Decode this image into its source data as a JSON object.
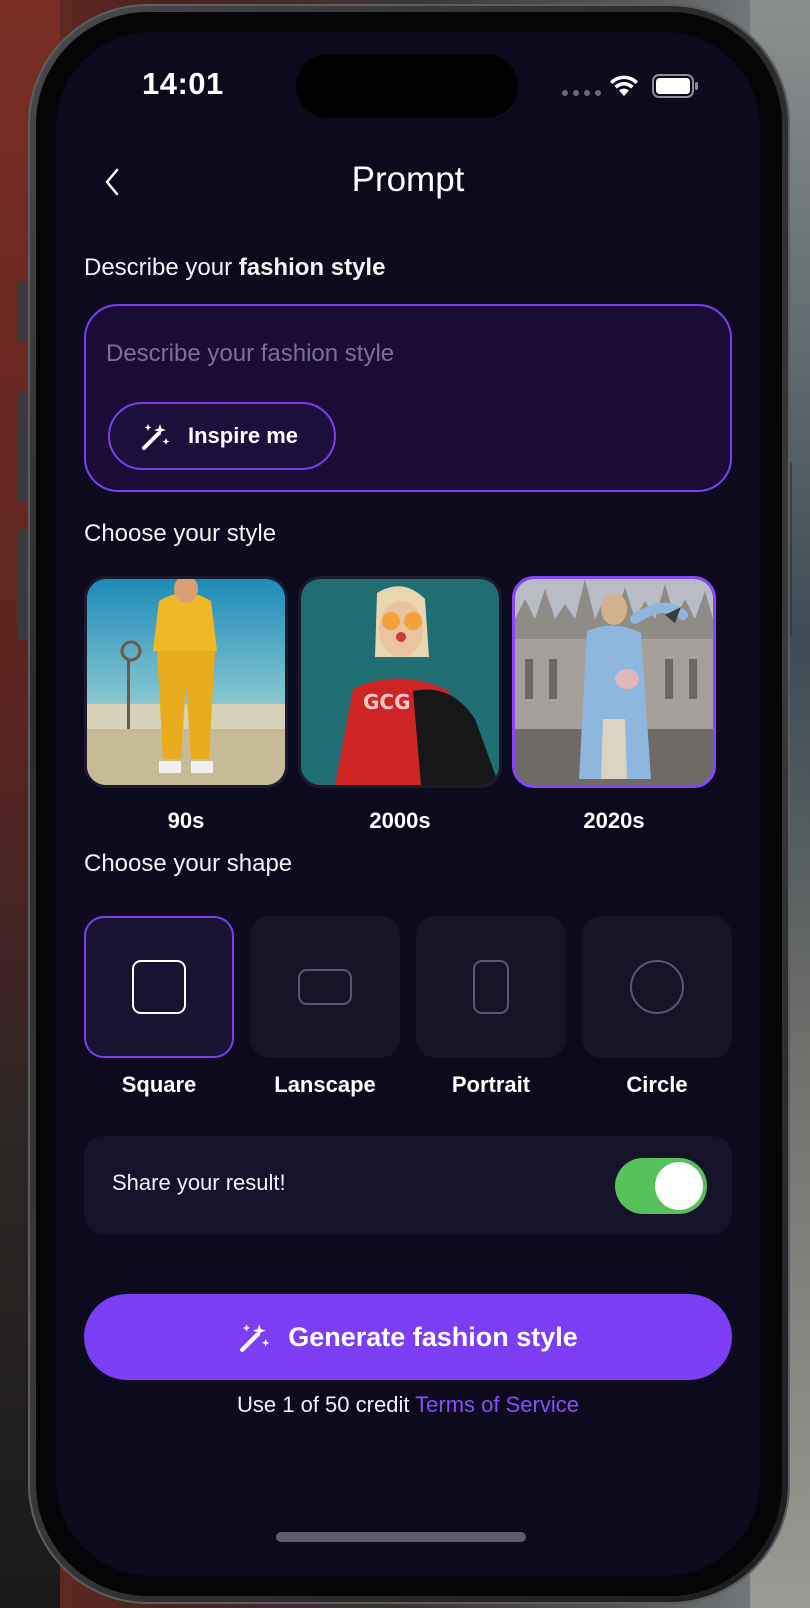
{
  "status_bar": {
    "time": "14:01"
  },
  "header": {
    "title": "Prompt"
  },
  "prompt_section": {
    "label_prefix": "Describe your ",
    "label_bold": "fashion style",
    "input_placeholder": "Describe your fashion style",
    "input_value": "",
    "inspire_label": "Inspire me"
  },
  "style_section": {
    "label": "Choose your style",
    "items": [
      {
        "label": "90s",
        "selected": false
      },
      {
        "label": "2000s",
        "selected": false
      },
      {
        "label": "2020s",
        "selected": true
      }
    ]
  },
  "shape_section": {
    "label": "Choose your shape",
    "items": [
      {
        "label": "Square",
        "selected": true
      },
      {
        "label": "Lanscape",
        "selected": false
      },
      {
        "label": "Portrait",
        "selected": false
      },
      {
        "label": "Circle",
        "selected": false
      }
    ]
  },
  "share": {
    "label": "Share your result!",
    "enabled": true
  },
  "generate": {
    "label": "Generate fashion style"
  },
  "footer": {
    "credit_text": "Use 1 of 50 credit ",
    "tos_label": "Terms of Service"
  },
  "colors": {
    "background": "#0c0a1c",
    "accent": "#7b3ef5",
    "link": "#8a4dff",
    "toggle_on": "#56c05a",
    "card": "#161427"
  },
  "icons": [
    "back-chevron-icon",
    "wifi-icon",
    "battery-icon",
    "magic-wand-icon"
  ]
}
